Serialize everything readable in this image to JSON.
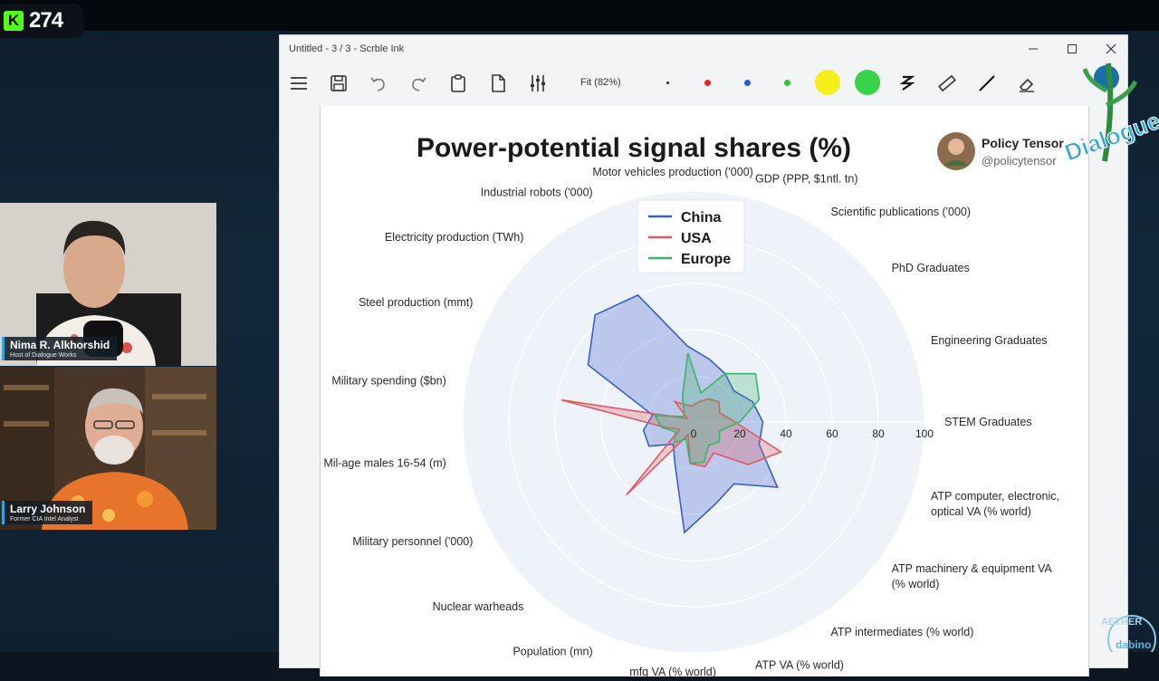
{
  "stream": {
    "viewer_count": "274",
    "platform_icon": "kick-logo-icon"
  },
  "participants": [
    {
      "name": "Nima R. Alkhorshid",
      "role": "Host of Dialogue Works"
    },
    {
      "name": "Larry Johnson",
      "role": "Former CIA Intel Analyst"
    }
  ],
  "window": {
    "title": "Untitled - 3 / 3 - Scrble Ink",
    "zoom_label": "Fit (82%)"
  },
  "toolbar_colors": {
    "black": "#222222",
    "red": "#e0262a",
    "blue": "#2b5fd9",
    "green": "#39c142",
    "yellow": "#f5ee1a",
    "bright_green": "#35d44a"
  },
  "chart": {
    "title": "Power-potential signal shares (%)",
    "author_name": "Policy Tensor",
    "author_handle": "@policytensor"
  },
  "overlay": {
    "logo_text": "Dialogue Works",
    "bottom_logo_text": "AETHER",
    "bottom_logo_sub": "dabino"
  },
  "chart_data": {
    "type": "radar",
    "axes": [
      "STEM Graduates",
      "Engineering Graduates",
      "PhD Graduates",
      "Scientific publications ('000)",
      "GDP (PPP, $1ntl. tn)",
      "Motor vehicles production ('000)",
      "Industrial robots ('000)",
      "Electricity production (TWh)",
      "Steel production (mmt)",
      "Military spending ($bn)",
      "Mil-age males 16-54 (m)",
      "Military personnel ('000)",
      "Nuclear warheads",
      "Population (mn)",
      "mfg VA (% world)",
      "ATP VA (% world)",
      "ATP intermediates (% world)",
      "ATP machinery & equipment VA (% world)",
      "ATP computer, electronic, optical VA (% world)"
    ],
    "radial_ticks": [
      0,
      20,
      40,
      60,
      80,
      100
    ],
    "rlim": [
      0,
      100
    ],
    "series": [
      {
        "name": "China",
        "color": "#3a5fc8",
        "values": [
          30,
          27,
          22,
          25,
          28,
          33,
          60,
          63,
          52,
          18,
          22,
          22,
          13,
          20,
          48,
          37,
          32,
          46,
          30
        ]
      },
      {
        "name": "USA",
        "color": "#e05a60",
        "values": [
          18,
          12,
          14,
          12,
          9,
          7,
          8,
          12,
          3,
          58,
          13,
          7,
          43,
          6,
          18,
          20,
          16,
          30,
          40
        ]
      },
      {
        "name": "Europe",
        "color": "#3db36a",
        "values": [
          20,
          30,
          34,
          25,
          13,
          30,
          12,
          6,
          5,
          17,
          14,
          9,
          12,
          8,
          18,
          18,
          12,
          14,
          12
        ]
      }
    ],
    "legend_position": "top-center",
    "grid": true
  }
}
